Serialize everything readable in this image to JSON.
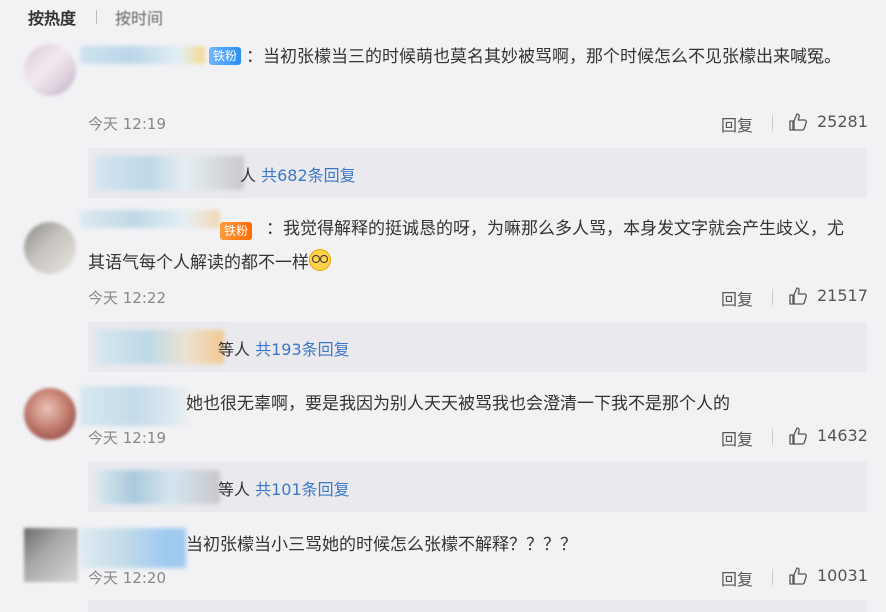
{
  "sort": {
    "hot_label": "按热度",
    "time_label": "按时间"
  },
  "comments": [
    {
      "badge": "铁粉",
      "text": "：当初张檬当三的时候萌也莫名其妙被骂啊，那个时候怎么不见张檬出来喊冤。",
      "time": "今天 12:19",
      "reply_label": "回复",
      "likes": "25281",
      "replies": {
        "suffix": "人",
        "count_text": "共682条回复"
      }
    },
    {
      "badge": "铁粉",
      "text": "：我觉得解释的挺诚恳的呀，为嘛那么多人骂，本身发文字就会产生歧义，尤其语气每个人解读的都不一样",
      "time": "今天 12:22",
      "reply_label": "回复",
      "likes": "21517",
      "replies": {
        "suffix": "等人",
        "count_text": "共193条回复"
      }
    },
    {
      "text": "她也很无辜啊，要是我因为别人天天被骂我也会澄清一下我不是那个人的",
      "time": "今天 12:19",
      "reply_label": "回复",
      "likes": "14632",
      "replies": {
        "suffix": "等人",
        "count_text": "共101条回复"
      }
    },
    {
      "text": "当初张檬当小三骂她的时候怎么张檬不解释？？？？",
      "time": "今天 12:20",
      "reply_label": "回复",
      "likes": "10031"
    }
  ],
  "colors": {
    "link_blue": "#3c78c8",
    "badge_blue": "#2b8ef0",
    "badge_orange": "#ff6a00",
    "background": "#f2f2f5"
  },
  "icons": [
    "like-icon",
    "emoji-face-icon"
  ]
}
